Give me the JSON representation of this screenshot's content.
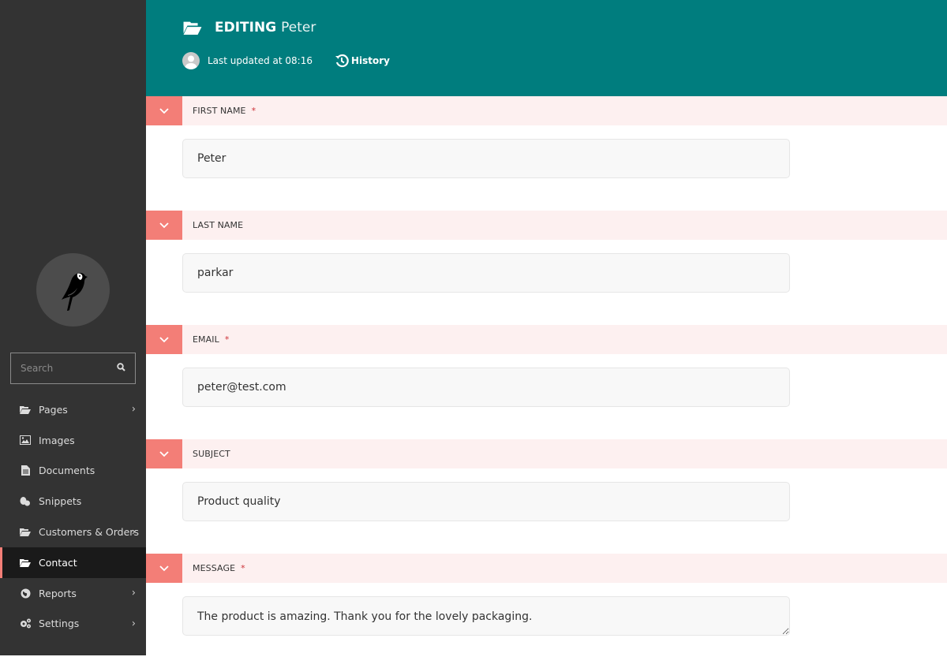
{
  "sidebar": {
    "logo_alt": "Wagtail bird logo",
    "search": {
      "placeholder": "Search",
      "value": ""
    },
    "items": [
      {
        "label": "Pages",
        "icon": "folder-open-icon",
        "has_submenu": true,
        "active": false
      },
      {
        "label": "Images",
        "icon": "image-icon",
        "has_submenu": false,
        "active": false
      },
      {
        "label": "Documents",
        "icon": "document-icon",
        "has_submenu": false,
        "active": false
      },
      {
        "label": "Snippets",
        "icon": "snippet-icon",
        "has_submenu": false,
        "active": false
      },
      {
        "label": "Customers & Orders",
        "icon": "folder-open-icon",
        "has_submenu": true,
        "active": false
      },
      {
        "label": "Contact",
        "icon": "folder-open-icon",
        "has_submenu": false,
        "active": true
      },
      {
        "label": "Reports",
        "icon": "globe-icon",
        "has_submenu": true,
        "active": false
      },
      {
        "label": "Settings",
        "icon": "cogs-icon",
        "has_submenu": true,
        "active": false
      }
    ]
  },
  "header": {
    "action": "EDITING",
    "object_name": "Peter",
    "last_updated": "Last updated at 08:16",
    "history_label": "History"
  },
  "colors": {
    "header_bg": "#007d7e",
    "sidebar_bg": "#333333",
    "accent": "#f37e77",
    "panel_head_bg": "#fdf0f0",
    "required": "#cd3238"
  },
  "form": {
    "fields": [
      {
        "label": "FIRST NAME",
        "required": true,
        "value": "Peter",
        "type": "text"
      },
      {
        "label": "LAST NAME",
        "required": false,
        "value": "parkar",
        "type": "text"
      },
      {
        "label": "EMAIL",
        "required": true,
        "value": "peter@test.com",
        "type": "text"
      },
      {
        "label": "SUBJECT",
        "required": false,
        "value": "Product quality",
        "type": "text"
      },
      {
        "label": "MESSAGE",
        "required": true,
        "value": "The product is amazing. Thank you for the lovely packaging.",
        "type": "textarea"
      }
    ],
    "required_marker": "*"
  }
}
